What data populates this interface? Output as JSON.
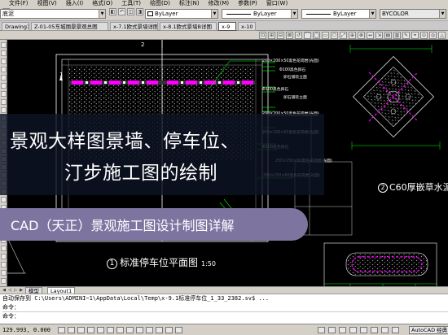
{
  "menubar": {
    "items": [
      "文件(F)",
      "视图(V)",
      "插入(I)",
      "格式(O)",
      "工具(T)",
      "绘图(D)",
      "标注(N)",
      "修改(M)",
      "参数(P)",
      "窗口(W)"
    ]
  },
  "properties": {
    "layer_value": "底泥",
    "color_value": "ByLayer",
    "linetype_value": "ByLayer",
    "lineweight_value": "ByLayer",
    "plotstyle_value": "BYCOLOR",
    "layer_color": "#ffffff"
  },
  "doc_tabs": [
    "Drawing1",
    "Z-01-05东城丽景景观总图",
    "x-7.1欧式景墙详图",
    "x-8.1欧式景墙B详图",
    "x-9",
    "x-10"
  ],
  "doc_tab_active_index": 4,
  "drawing": {
    "dims_lines": [
      "200×200×50黑色花岗岩(光面)",
      "Φ100黑色卵石",
      "卵石铺装立面",
      "Φ100黑色卵石",
      "卵石铺装立面",
      "200×200×50黑色花岗岩(光面)",
      "200×200×50黑色花岗岩(光面)",
      "Φ100黑色卵石"
    ],
    "small_num_1": "1",
    "small_num_2": "1",
    "small_num_3": "2",
    "dim_bottom": "250×250×60黑色花岗岩(光面)",
    "dim_bottom2": "250×250×60黑色花岗岩(光面)",
    "c60_num": "2",
    "c60_label": "C60厚嵌草水泥",
    "plan_num": "1",
    "plan_label": "标准停车位平面图",
    "plan_scale": "1:50"
  },
  "banner": {
    "title_line1": "景观大样图景墙、停车位、",
    "title_line2": "汀步施工图的绘制",
    "subtitle": "CAD（天正）景观施工图设计制图详解"
  },
  "layout_tabs": [
    "模型",
    "Layout1"
  ],
  "layout_tab_active_index": 1,
  "command": {
    "line1": "自动保存到 C:\\Users\\ADMINI~1\\AppData\\Local\\Temp\\x-9.1标准停车位_1_33_2382.sv$ ...",
    "line2": "命令：",
    "line3": "命令："
  },
  "status": {
    "coords": "129.993, 0.000",
    "app_label": "AutoCAD 经典"
  },
  "colors": {
    "accent_magenta": "#ff00ff",
    "accent_green": "#00ff00",
    "banner_dark": "#0e1426",
    "banner_purple": "#7d75a0"
  }
}
